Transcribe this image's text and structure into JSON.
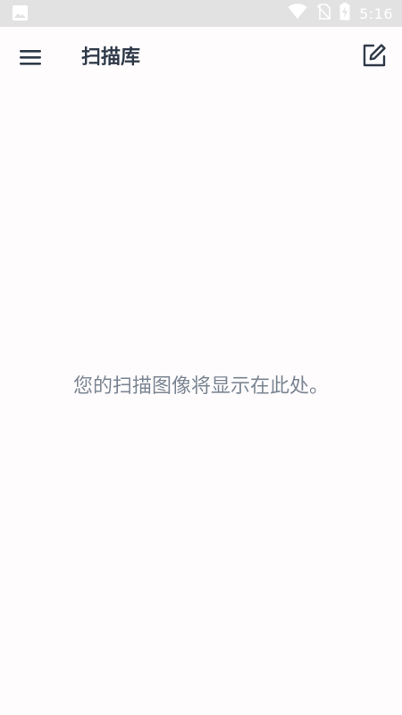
{
  "status_bar": {
    "time": "5:16",
    "icons": [
      "image-notification-icon",
      "wifi-icon",
      "no-sim-icon",
      "battery-charging-icon"
    ]
  },
  "app_bar": {
    "title": "扫描库",
    "menu_icon": "hamburger-menu-icon",
    "edit_icon": "edit-note-icon"
  },
  "main": {
    "empty_message": "您的扫描图像将显示在此处。"
  },
  "colors": {
    "background": "#fffcfd",
    "status_bar": "#e2e2e2",
    "title_text": "#2f3a49",
    "muted_text": "#7b8693"
  }
}
